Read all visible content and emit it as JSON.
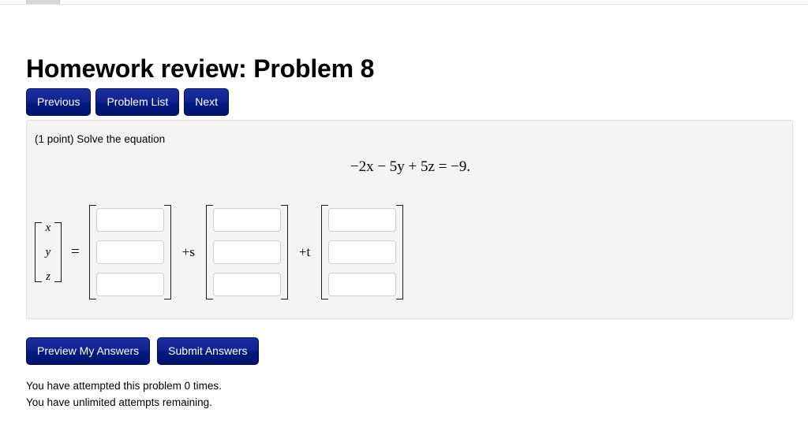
{
  "browser": {
    "tab_placeholder": ""
  },
  "header": {
    "title": "Homework review: Problem 8"
  },
  "nav": {
    "previous_label": "Previous",
    "problem_list_label": "Problem List",
    "next_label": "Next"
  },
  "problem": {
    "points_prompt": "(1 point) Solve the equation",
    "equation": "−2x − 5y + 5z = −9.",
    "vector_variables": [
      "x",
      "y",
      "z"
    ],
    "equals_sign": "=",
    "operator_s": "+s",
    "operator_t": "+t",
    "answer_vectors": [
      {
        "name": "particular",
        "values": [
          "",
          "",
          ""
        ],
        "placeholders": [
          "",
          "",
          ""
        ]
      },
      {
        "name": "direction-s",
        "values": [
          "",
          "",
          ""
        ],
        "placeholders": [
          "",
          "",
          ""
        ]
      },
      {
        "name": "direction-t",
        "values": [
          "",
          "",
          ""
        ],
        "placeholders": [
          "",
          "",
          ""
        ]
      }
    ]
  },
  "actions": {
    "preview_label": "Preview My Answers",
    "submit_label": "Submit Answers"
  },
  "status": {
    "attempts_line": "You have attempted this problem 0 times.",
    "remaining_line": "You have unlimited attempts remaining."
  },
  "colors": {
    "button_navy": "#0b1f8f",
    "panel_background": "#f4f4f4",
    "panel_border": "#e0e0e0",
    "input_border": "#cfcfcf",
    "page_background": "#ffffff"
  }
}
